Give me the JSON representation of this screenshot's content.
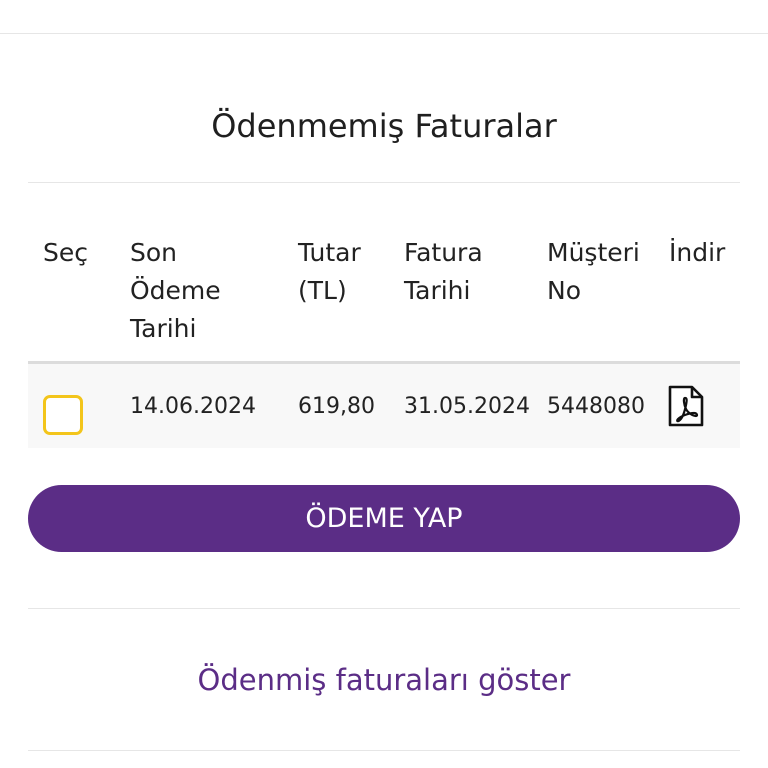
{
  "page_title": "Ödenmemiş Faturalar",
  "table": {
    "headers": {
      "select": "Seç",
      "due_date_line1": "Son",
      "due_date_line2": "Ödeme",
      "due_date_line3": "Tarihi",
      "amount_line1": "Tutar",
      "amount_line2": "(TL)",
      "invoice_date_line1": "Fatura",
      "invoice_date_line2": "Tarihi",
      "customer_no_line1": "Müşteri",
      "customer_no_line2": "No",
      "download": "İndir"
    },
    "rows": [
      {
        "selected": false,
        "due_date": "14.06.2024",
        "amount": "619,80",
        "invoice_date": "31.05.2024",
        "customer_no": "5448080",
        "download_icon": "pdf-icon"
      }
    ]
  },
  "pay_button_label": "ÖDEME YAP",
  "show_paid_link": "Ödenmiş faturaları göster",
  "colors": {
    "brand_purple": "#5b2d86",
    "checkbox_border": "#f3c51b"
  }
}
